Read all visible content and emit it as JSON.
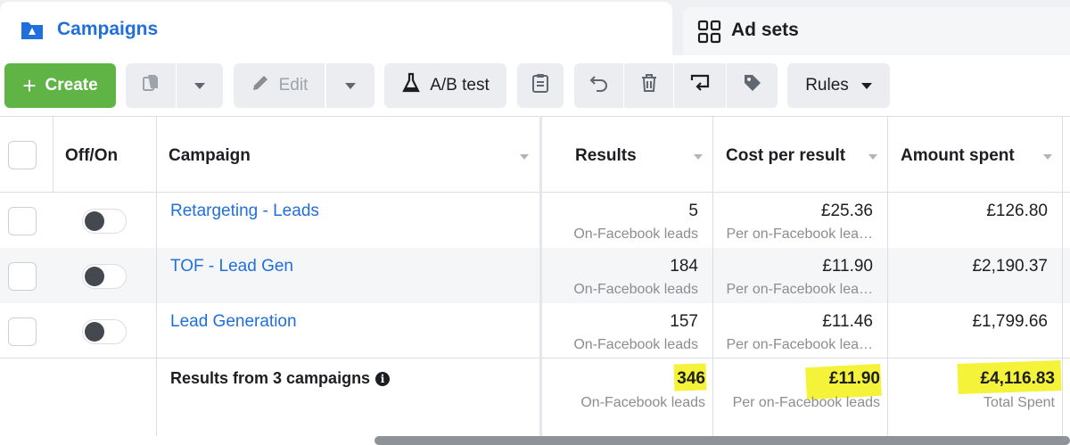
{
  "tabs": [
    {
      "label": "Campaigns",
      "icon": "folder-icon",
      "active": true
    },
    {
      "label": "Ad sets",
      "icon": "grid-icon",
      "active": false
    }
  ],
  "toolbar": {
    "create_label": "Create",
    "edit_label": "Edit",
    "ab_test_label": "A/B test",
    "rules_label": "Rules"
  },
  "table": {
    "headers": {
      "toggle": "Off/On",
      "campaign": "Campaign",
      "results": "Results",
      "cost_per_result": "Cost per result",
      "amount_spent": "Amount spent"
    },
    "rows": [
      {
        "name": "Retargeting - Leads",
        "results": "5",
        "results_sub": "On-Facebook leads",
        "cost": "£25.36",
        "cost_sub": "Per on-Facebook lea…",
        "spent": "£126.80"
      },
      {
        "name": "TOF - Lead Gen",
        "results": "184",
        "results_sub": "On-Facebook leads",
        "cost": "£11.90",
        "cost_sub": "Per on-Facebook lea…",
        "spent": "£2,190.37"
      },
      {
        "name": "Lead Generation",
        "results": "157",
        "results_sub": "On-Facebook leads",
        "cost": "£11.46",
        "cost_sub": "Per on-Facebook lea…",
        "spent": "£1,799.66"
      }
    ],
    "totals": {
      "label": "Results from 3 campaigns",
      "results": "346",
      "results_sub": "On-Facebook leads",
      "cost": "£11.90",
      "cost_sub": "Per on-Facebook leads",
      "spent": "£4,116.83",
      "spent_sub": "Total Spent"
    }
  },
  "colors": {
    "accent_blue": "#216fdb",
    "create_green": "#5fb445",
    "highlight_yellow": "#f5f23a"
  }
}
